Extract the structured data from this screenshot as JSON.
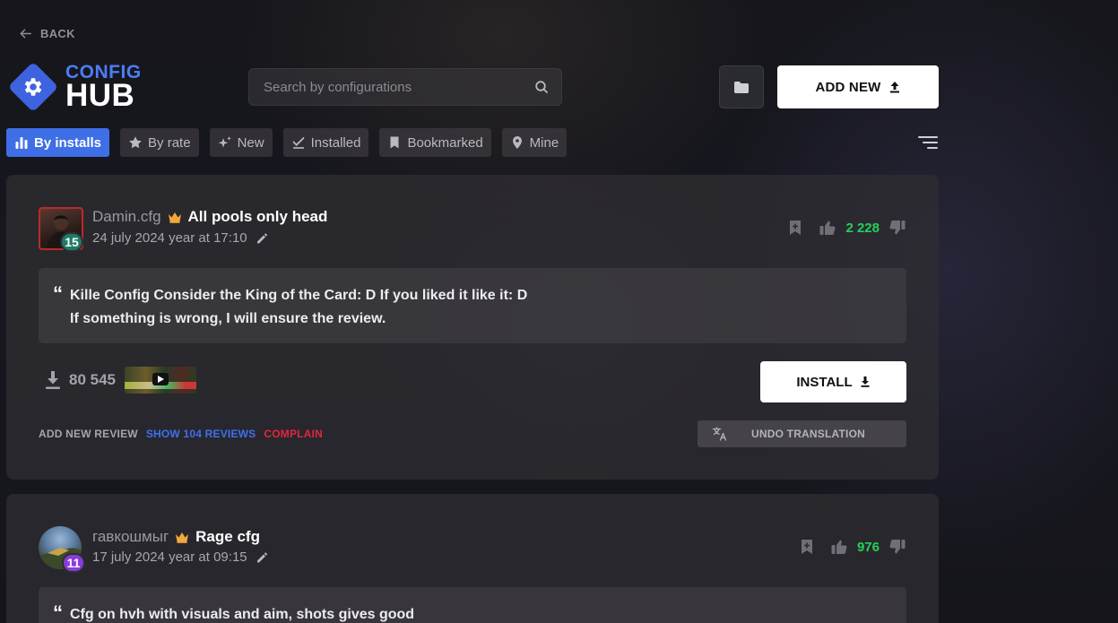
{
  "header": {
    "back_label": "BACK",
    "logo_top": "CONFIG",
    "logo_bottom": "HUB",
    "search_placeholder": "Search by configurations",
    "add_new_label": "ADD NEW"
  },
  "tabs": [
    {
      "label": "By installs",
      "icon": "bar-chart-icon",
      "active": true
    },
    {
      "label": "By rate",
      "icon": "star-icon",
      "active": false
    },
    {
      "label": "New",
      "icon": "sparkle-icon",
      "active": false
    },
    {
      "label": "Installed",
      "icon": "check-icon",
      "active": false
    },
    {
      "label": "Bookmarked",
      "icon": "bookmark-icon",
      "active": false
    },
    {
      "label": "Mine",
      "icon": "location-pin-icon",
      "active": false
    }
  ],
  "configs": [
    {
      "author": "Damin.cfg",
      "title": "All pools only head",
      "date": "24 july 2024 year at 17:10",
      "level": "15",
      "likes": "2 228",
      "quote_line1": "Kille Config Consider the King of the Card: D If you liked it like it: D",
      "quote_line2": "If something is wrong, I will ensure the review.",
      "downloads": "80 545",
      "install_label": "INSTALL",
      "add_review_label": "ADD NEW REVIEW",
      "show_reviews_label": "SHOW 104 REVIEWS",
      "complain_label": "COMPLAIN",
      "undo_translation_label": "UNDO TRANSLATION"
    },
    {
      "author": "гавкошмыг",
      "title": "Rage cfg",
      "date": "17 july 2024 year at 09:15",
      "level": "11",
      "likes": "976",
      "quote_line1": "Cfg on hvh with visuals and aim, shots gives good"
    }
  ],
  "colors": {
    "accent": "#3f6fe6",
    "like_green": "#22d15a",
    "complain_red": "#e2253f",
    "level_teal": "#1f7a66",
    "level_purple": "#8a3bdc"
  }
}
